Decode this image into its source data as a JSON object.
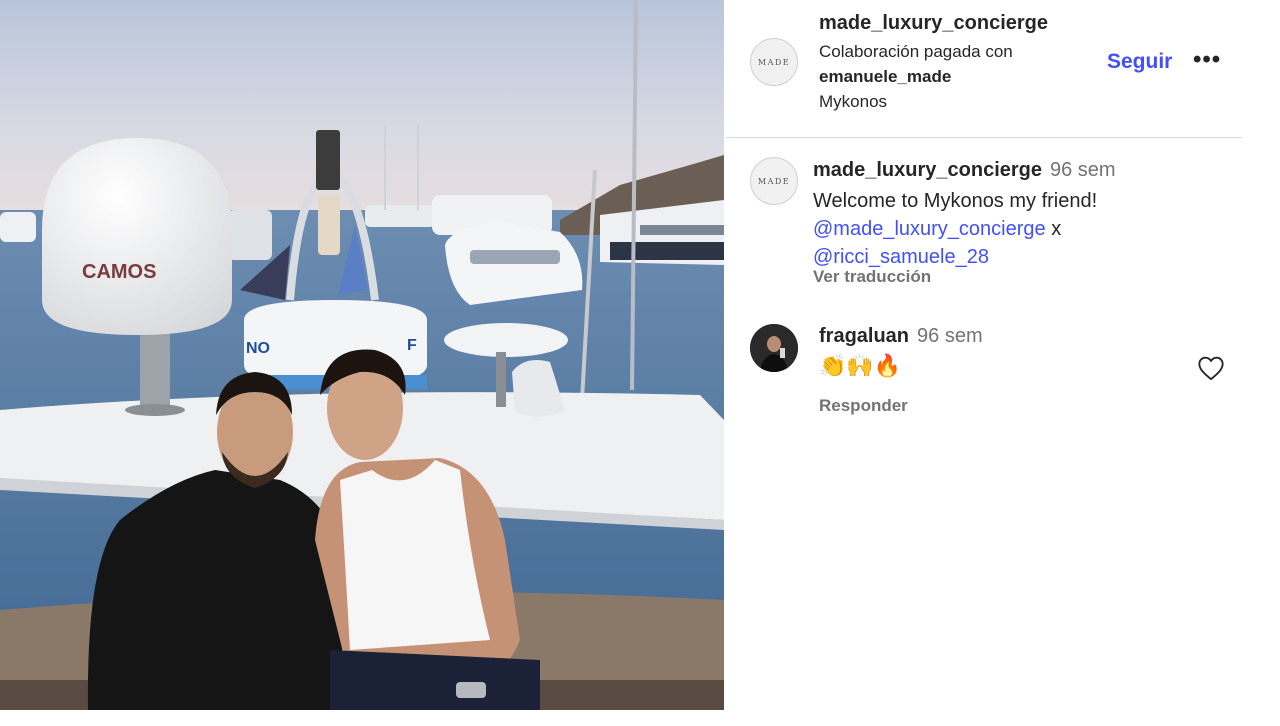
{
  "post": {
    "photo_alt": "Two men sitting on the deck of a yacht in a harbour at dusk",
    "photo_text": {
      "dome_brand": "CAMOS",
      "dome2_left": "NO",
      "dome2_right": "F"
    }
  },
  "header": {
    "avatar_text": "MADE",
    "username": "made_luxury_concierge",
    "paid_partnership": "Colaboración pagada con",
    "partner": "emanuele_made",
    "location": "Mykonos",
    "follow_label": "Seguir",
    "more_label": "•••"
  },
  "comments": [
    {
      "avatar_text": "MADE",
      "username": "made_luxury_concierge",
      "time": "96 sem",
      "text": "Welcome to Mykonos my friend!",
      "mention1": "@made_luxury_concierge",
      "separator": " x",
      "mention2": "@ricci_samuele_28",
      "translate_label": "Ver traducción"
    },
    {
      "username": "fragaluan",
      "time": "96 sem",
      "text": "👏🙌🔥",
      "reply_label": "Responder"
    }
  ],
  "colors": {
    "link": "#4150f7",
    "text": "#262626",
    "secondary": "#737373",
    "divider": "#dbdbdb"
  },
  "icons": {
    "more": "more-options-icon",
    "like": "heart-outline-icon"
  }
}
